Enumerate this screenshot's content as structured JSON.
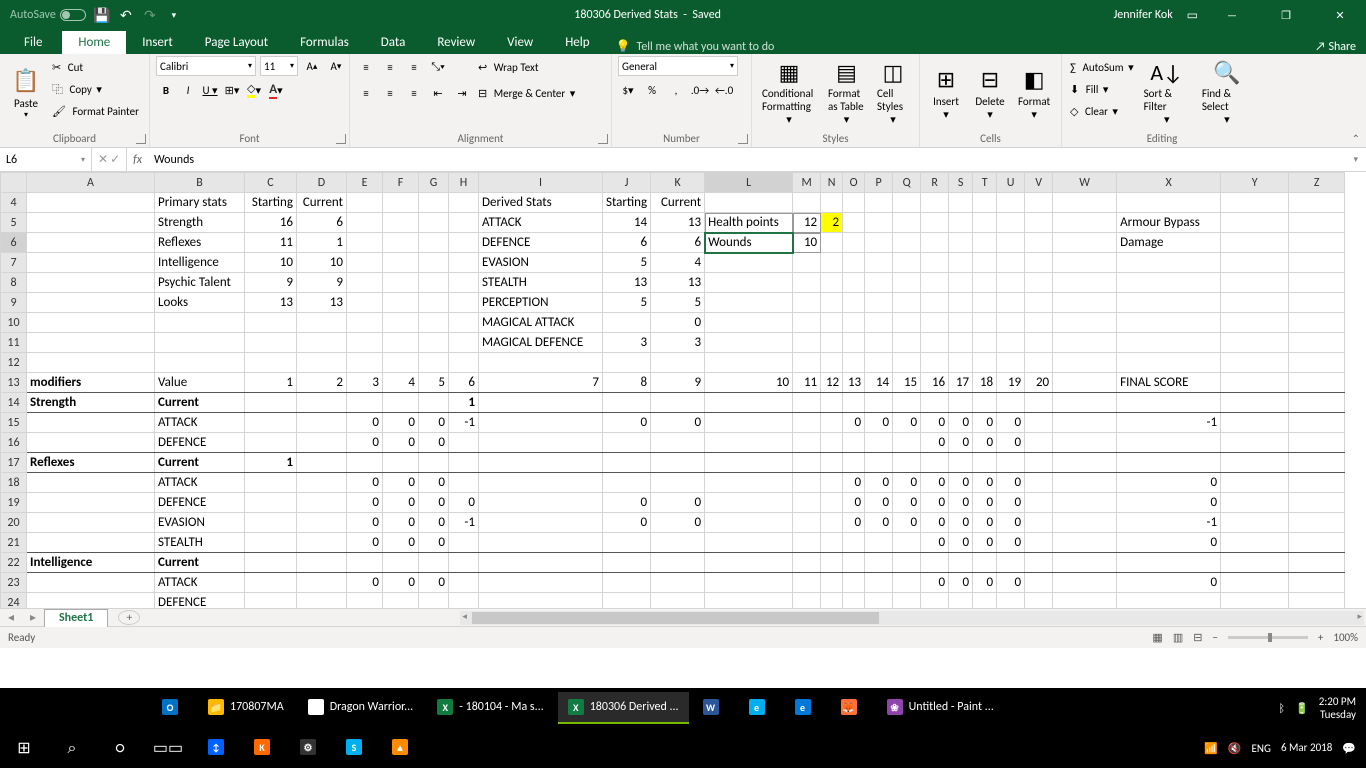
{
  "titlebar": {
    "autosave": "AutoSave",
    "doc_title": "180306 Derived Stats",
    "saved": "Saved",
    "user": "Jennifer Kok"
  },
  "tabs": {
    "file": "File",
    "home": "Home",
    "insert": "Insert",
    "page_layout": "Page Layout",
    "formulas": "Formulas",
    "data": "Data",
    "review": "Review",
    "view": "View",
    "help": "Help",
    "tellme": "Tell me what you want to do",
    "share": "Share"
  },
  "ribbon": {
    "paste": "Paste",
    "cut": "Cut",
    "copy": "Copy",
    "format_painter": "Format Painter",
    "clipboard": "Clipboard",
    "font_name": "Calibri",
    "font_size": "11",
    "font_group": "Font",
    "wrap": "Wrap Text",
    "merge": "Merge & Center",
    "alignment": "Alignment",
    "number_format": "General",
    "number": "Number",
    "cond_fmt": "Conditional Formatting",
    "fmt_table": "Format as Table",
    "cell_styles": "Cell Styles",
    "styles": "Styles",
    "insert": "Insert",
    "delete": "Delete",
    "format": "Format",
    "cells": "Cells",
    "autosum": "AutoSum",
    "fill": "Fill",
    "clear": "Clear",
    "sort_filter": "Sort & Filter",
    "find_select": "Find & Select",
    "editing": "Editing"
  },
  "formula": {
    "cell_ref": "L6",
    "value": "Wounds"
  },
  "columns": [
    "A",
    "B",
    "C",
    "D",
    "E",
    "F",
    "G",
    "H",
    "I",
    "J",
    "K",
    "L",
    "M",
    "N",
    "O",
    "P",
    "Q",
    "R",
    "S",
    "T",
    "U",
    "V",
    "W",
    "X",
    "Y",
    "Z"
  ],
  "row_headers": [
    "4",
    "5",
    "6",
    "7",
    "8",
    "9",
    "10",
    "11",
    "12",
    "13",
    "14",
    "15",
    "16",
    "17",
    "18",
    "19",
    "20",
    "21",
    "22",
    "23",
    "24"
  ],
  "cells": {
    "4": {
      "B": "Primary stats",
      "C": "Starting",
      "D": "Current",
      "I": "Derived Stats",
      "J": "Starting",
      "K": "Current"
    },
    "5": {
      "B": "Strength",
      "C": "16",
      "D": "6",
      "I": "ATTACK",
      "J": "14",
      "K": "13",
      "L": "Health points",
      "M": "12",
      "N": "2",
      "X": "Armour Bypass"
    },
    "6": {
      "B": "Reflexes",
      "C": "11",
      "D": "1",
      "I": "DEFENCE",
      "J": "6",
      "K": "6",
      "L": "Wounds",
      "M": "10",
      "X": "Damage"
    },
    "7": {
      "B": "Intelligence",
      "C": "10",
      "D": "10",
      "I": "EVASION",
      "J": "5",
      "K": "4"
    },
    "8": {
      "B": "Psychic Talent",
      "C": "9",
      "D": "9",
      "I": "STEALTH",
      "J": "13",
      "K": "13"
    },
    "9": {
      "B": "Looks",
      "C": "13",
      "D": "13",
      "I": "PERCEPTION",
      "J": "5",
      "K": "5"
    },
    "10": {
      "I": "MAGICAL ATTACK",
      "K": "0"
    },
    "11": {
      "I": "MAGICAL DEFENCE",
      "J": "3",
      "K": "3"
    },
    "12": {},
    "13": {
      "A": "modifiers",
      "B": "Value",
      "C": "1",
      "D": "2",
      "E": "3",
      "F": "4",
      "G": "5",
      "H": "6",
      "I": "7",
      "J": "8",
      "K": "9",
      "L": "10",
      "M": "11",
      "N": "12",
      "O": "13",
      "P": "14",
      "Q": "15",
      "R": "16",
      "S": "17",
      "T": "18",
      "U": "19",
      "V": "20",
      "X": "FINAL SCORE"
    },
    "14": {
      "A": "Strength",
      "B": "Current",
      "H": "1"
    },
    "15": {
      "B": "ATTACK",
      "E": "0",
      "F": "0",
      "G": "0",
      "H": "-1",
      "J": "0",
      "K": "0",
      "O": "0",
      "P": "0",
      "Q": "0",
      "R": "0",
      "S": "0",
      "T": "0",
      "U": "0",
      "X": "-1"
    },
    "16": {
      "B": "DEFENCE",
      "E": "0",
      "F": "0",
      "G": "0",
      "R": "0",
      "S": "0",
      "T": "0",
      "U": "0"
    },
    "17": {
      "A": "Reflexes",
      "B": "Current",
      "C": "1"
    },
    "18": {
      "B": "ATTACK",
      "E": "0",
      "F": "0",
      "G": "0",
      "O": "0",
      "P": "0",
      "Q": "0",
      "R": "0",
      "S": "0",
      "T": "0",
      "U": "0",
      "X": "0"
    },
    "19": {
      "B": "DEFENCE",
      "E": "0",
      "F": "0",
      "G": "0",
      "H": "0",
      "J": "0",
      "K": "0",
      "O": "0",
      "P": "0",
      "Q": "0",
      "R": "0",
      "S": "0",
      "T": "0",
      "U": "0",
      "X": "0"
    },
    "20": {
      "B": "EVASION",
      "E": "0",
      "F": "0",
      "G": "0",
      "H": "-1",
      "J": "0",
      "K": "0",
      "O": "0",
      "P": "0",
      "Q": "0",
      "R": "0",
      "S": "0",
      "T": "0",
      "U": "0",
      "X": "-1"
    },
    "21": {
      "B": "STEALTH",
      "E": "0",
      "F": "0",
      "G": "0",
      "R": "0",
      "S": "0",
      "T": "0",
      "U": "0",
      "X": "0"
    },
    "22": {
      "A": "Intelligence",
      "B": "Current"
    },
    "23": {
      "B": "ATTACK",
      "E": "0",
      "F": "0",
      "G": "0",
      "R": "0",
      "S": "0",
      "T": "0",
      "U": "0",
      "X": "0"
    },
    "24": {
      "B": "DEFENCE",
      "E": "",
      "F": "",
      "G": ""
    }
  },
  "numeric_cols": [
    "C",
    "D",
    "E",
    "F",
    "G",
    "H",
    "J",
    "K",
    "M",
    "N",
    "O",
    "P",
    "Q",
    "R",
    "S",
    "T",
    "U",
    "V"
  ],
  "sheet": {
    "name": "Sheet1"
  },
  "status": {
    "ready": "Ready",
    "zoom": "100%"
  },
  "taskbar": {
    "tasks": [
      {
        "icon": "O",
        "bg": "#0072c6",
        "label": ""
      },
      {
        "icon": "📁",
        "bg": "#ffb900",
        "label": "170807MA"
      },
      {
        "icon": "◎",
        "bg": "#fff",
        "label": "Dragon Warrior..."
      },
      {
        "icon": "X",
        "bg": "#107c41",
        "label": "- 180104 - Ma s..."
      },
      {
        "icon": "X",
        "bg": "#107c41",
        "label": "180306 Derived ...",
        "active": true
      },
      {
        "icon": "W",
        "bg": "#2b579a",
        "label": ""
      },
      {
        "icon": "e",
        "bg": "#00adef",
        "label": ""
      },
      {
        "icon": "e",
        "bg": "#0078d7",
        "label": ""
      },
      {
        "icon": "🦊",
        "bg": "#ff7139",
        "label": ""
      },
      {
        "icon": "❀",
        "bg": "#8e44ad",
        "label": "Untitled - Paint ..."
      }
    ],
    "tasks2": [
      {
        "icon": "↕",
        "bg": "#0061ff"
      },
      {
        "icon": "K",
        "bg": "#ff6a00"
      },
      {
        "icon": "⚙",
        "bg": "#333"
      },
      {
        "icon": "S",
        "bg": "#00aff0"
      },
      {
        "icon": "▲",
        "bg": "#ff8c00"
      }
    ],
    "lang": "ENG",
    "time": "2:20 PM",
    "day": "Tuesday",
    "date": "6 Mar 2018"
  }
}
